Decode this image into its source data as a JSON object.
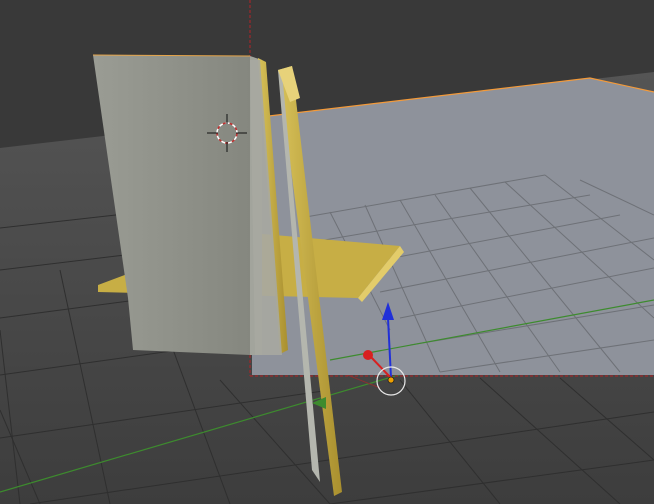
{
  "viewport": {
    "editor": "3d-view",
    "view": "user-perspective",
    "colors": {
      "background": "#393939",
      "floor_grid_near": "#4a4a4a",
      "floor_grid_far": "#5a5a5a",
      "grid_lines": "#2e2e2e",
      "backdrop_plane": "#8f939c",
      "backdrop_grid": "#6b6e74",
      "selection_outline": "#f39a3a",
      "x_axis": "#b53535",
      "y_axis": "#3d8b2e",
      "object_gray": "#8e9087",
      "object_gold": "#c9b24a",
      "camera_border": "#a0282b"
    }
  },
  "scene_objects": [
    {
      "name": "gray-panel",
      "selected": true
    },
    {
      "name": "gold-panel-back",
      "selected": true
    },
    {
      "name": "gold-panel-front",
      "selected": true
    },
    {
      "name": "gold-shelf",
      "selected": true
    },
    {
      "name": "backdrop-plane",
      "selected": true
    }
  ],
  "widgets": {
    "cursor_3d": {
      "icon": "3d-cursor-icon"
    },
    "manipulator": {
      "axis_z_color": "#2030d8",
      "axis_x_color": "#d82020",
      "pivot_color": "#f0a000"
    },
    "camera_frame": {
      "style": "dashed"
    }
  }
}
